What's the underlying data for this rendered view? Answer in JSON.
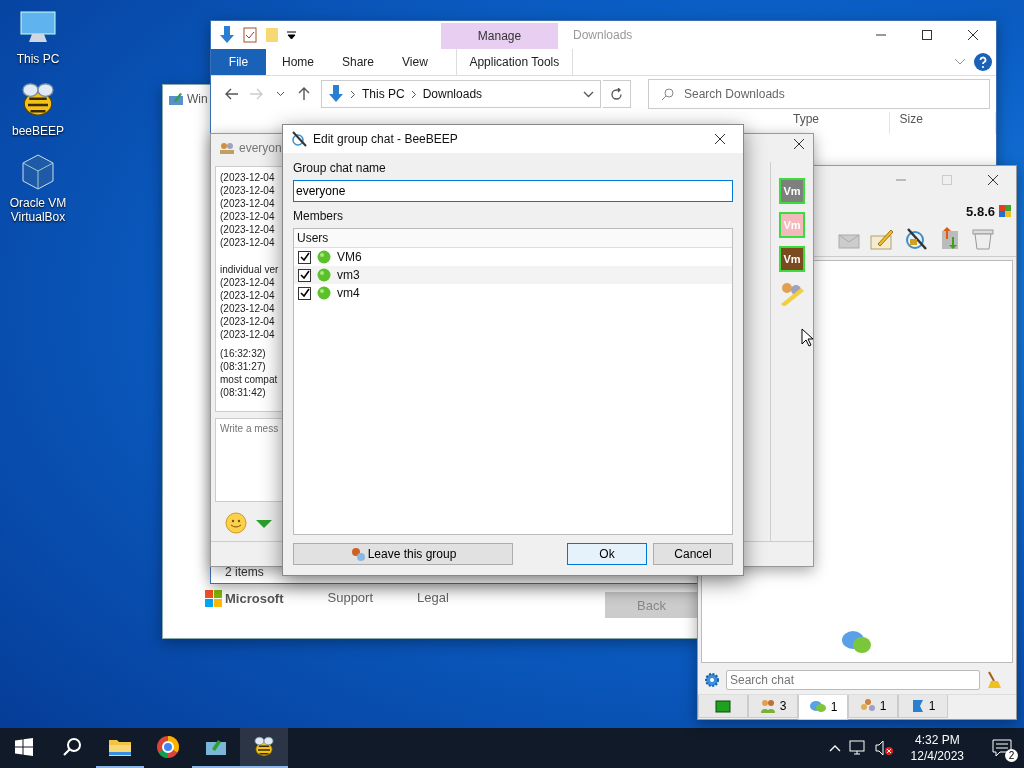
{
  "desktop_icons": [
    {
      "kind": "pc",
      "label": "This PC"
    },
    {
      "kind": "bee",
      "label": "beeBEEP"
    },
    {
      "kind": "vbox",
      "label": "Oracle VM VirtualBox"
    }
  ],
  "setup_window": {
    "title": "Win",
    "brand": "Microsoft",
    "links": [
      "Support",
      "Legal"
    ],
    "back_button": "Back"
  },
  "explorer": {
    "context_tab": "Manage",
    "title": "Downloads",
    "ribbon_tabs": [
      {
        "kind": "file",
        "label": "File"
      },
      {
        "kind": "plain",
        "label": "Home"
      },
      {
        "kind": "plain",
        "label": "Share"
      },
      {
        "kind": "plain",
        "label": "View"
      },
      {
        "kind": "context",
        "label": "Application Tools"
      }
    ],
    "breadcrumbs": [
      "This PC",
      "Downloads"
    ],
    "search_placeholder": "Search Downloads",
    "columns": [
      "Type",
      "Size"
    ],
    "status": "2 items"
  },
  "chat_window": {
    "title": "everyon",
    "message_blocks": [
      [
        "(2023-12-04",
        "(2023-12-04",
        "(2023-12-04",
        "(2023-12-04",
        "(2023-12-04",
        "(2023-12-04"
      ],
      [
        "individual ver",
        "(2023-12-04",
        "(2023-12-04",
        "(2023-12-04",
        "(2023-12-04",
        "(2023-12-04"
      ],
      [
        "(16:32:32)",
        "(08:31:27)",
        "most compat",
        "(08:31:42)"
      ]
    ],
    "placeholder": "Write a mess",
    "avatars": [
      {
        "label": "Vm",
        "color": "#7f7f7f"
      },
      {
        "label": "Vm",
        "color": "#f3b9bd"
      },
      {
        "label": "Vm",
        "color": "#7b4a1f"
      }
    ]
  },
  "main_window": {
    "version": "5.8.6",
    "search_placeholder": "Search chat",
    "tabs": [
      {
        "kind": "status",
        "selected": false
      },
      {
        "kind": "users",
        "count": "3",
        "selected": false
      },
      {
        "kind": "chats",
        "count": "1",
        "selected": true
      },
      {
        "kind": "groups",
        "count": "1",
        "selected": false
      },
      {
        "kind": "shares",
        "count": "1",
        "selected": false
      }
    ]
  },
  "dialog": {
    "title": "Edit group chat - BeeBEEP",
    "name_label": "Group chat name",
    "name_value": "everyone",
    "members_label": "Members",
    "list_header": "Users",
    "members": [
      {
        "name": "VM6",
        "checked": true
      },
      {
        "name": "vm3",
        "checked": true
      },
      {
        "name": "vm4",
        "checked": true
      }
    ],
    "leave_button": "Leave this group",
    "ok_button": "Ok",
    "cancel_button": "Cancel"
  },
  "taskbar": {
    "apps": [
      {
        "kind": "explorer",
        "running": true,
        "active": false
      },
      {
        "kind": "chrome",
        "running": false,
        "active": false
      },
      {
        "kind": "vbox",
        "running": true,
        "active": false
      },
      {
        "kind": "bee",
        "running": true,
        "active": true
      }
    ],
    "time": "4:32 PM",
    "date": "12/4/2023",
    "notifications": "2"
  }
}
